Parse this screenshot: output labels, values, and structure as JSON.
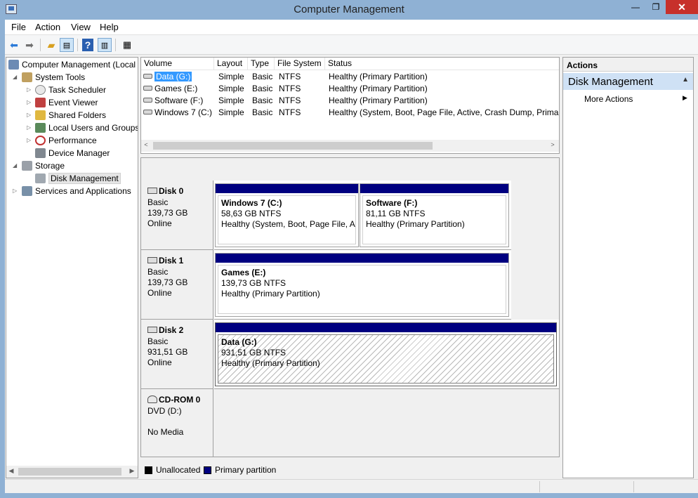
{
  "window": {
    "title": "Computer Management",
    "min": "—",
    "max": "❐",
    "close": "✕"
  },
  "menu": [
    "File",
    "Action",
    "View",
    "Help"
  ],
  "toolbar_icons": [
    "back-icon",
    "forward-icon",
    "up-folder-icon",
    "show-hide-tree-icon",
    "help-icon",
    "show-hide-action-pane-icon",
    "properties-icon"
  ],
  "tree": {
    "root": "Computer Management (Local",
    "system_tools": "System Tools",
    "task_scheduler": "Task Scheduler",
    "event_viewer": "Event Viewer",
    "shared_folders": "Shared Folders",
    "local_users": "Local Users and Groups",
    "performance": "Performance",
    "device_manager": "Device Manager",
    "storage": "Storage",
    "disk_management": "Disk Management",
    "services": "Services and Applications"
  },
  "volumes": {
    "headers": [
      "Volume",
      "Layout",
      "Type",
      "File System",
      "Status"
    ],
    "rows": [
      {
        "name": "Data (G:)",
        "layout": "Simple",
        "type": "Basic",
        "fs": "NTFS",
        "status": "Healthy (Primary Partition)"
      },
      {
        "name": "Games (E:)",
        "layout": "Simple",
        "type": "Basic",
        "fs": "NTFS",
        "status": "Healthy (Primary Partition)"
      },
      {
        "name": "Software (F:)",
        "layout": "Simple",
        "type": "Basic",
        "fs": "NTFS",
        "status": "Healthy (Primary Partition)"
      },
      {
        "name": "Windows 7 (C:)",
        "layout": "Simple",
        "type": "Basic",
        "fs": "NTFS",
        "status": "Healthy (System, Boot, Page File, Active, Crash Dump, Primary"
      }
    ]
  },
  "disks": [
    {
      "name": "Disk 0",
      "type": "Basic",
      "size": "139,73 GB",
      "state": "Online",
      "partitions": [
        {
          "name": "Windows 7  (C:)",
          "size": "58,63 GB NTFS",
          "status": "Healthy (System, Boot, Page File, Ac"
        },
        {
          "name": "Software  (F:)",
          "size": "81,11 GB NTFS",
          "status": "Healthy (Primary Partition)"
        }
      ]
    },
    {
      "name": "Disk 1",
      "type": "Basic",
      "size": "139,73 GB",
      "state": "Online",
      "partitions": [
        {
          "name": "Games  (E:)",
          "size": "139,73 GB NTFS",
          "status": "Healthy (Primary Partition)"
        }
      ]
    },
    {
      "name": "Disk 2",
      "type": "Basic",
      "size": "931,51 GB",
      "state": "Online",
      "partitions": [
        {
          "name": "Data  (G:)",
          "size": "931,51 GB NTFS",
          "status": "Healthy (Primary Partition)"
        }
      ]
    },
    {
      "name": "CD-ROM 0",
      "type": "DVD (D:)",
      "size": "",
      "state": "No Media",
      "partitions": []
    }
  ],
  "legend": {
    "unallocated": "Unallocated",
    "primary": "Primary partition",
    "unallocated_color": "#000000",
    "primary_color": "#000080"
  },
  "actions": {
    "header": "Actions",
    "section": "Disk Management",
    "item": "More Actions"
  }
}
